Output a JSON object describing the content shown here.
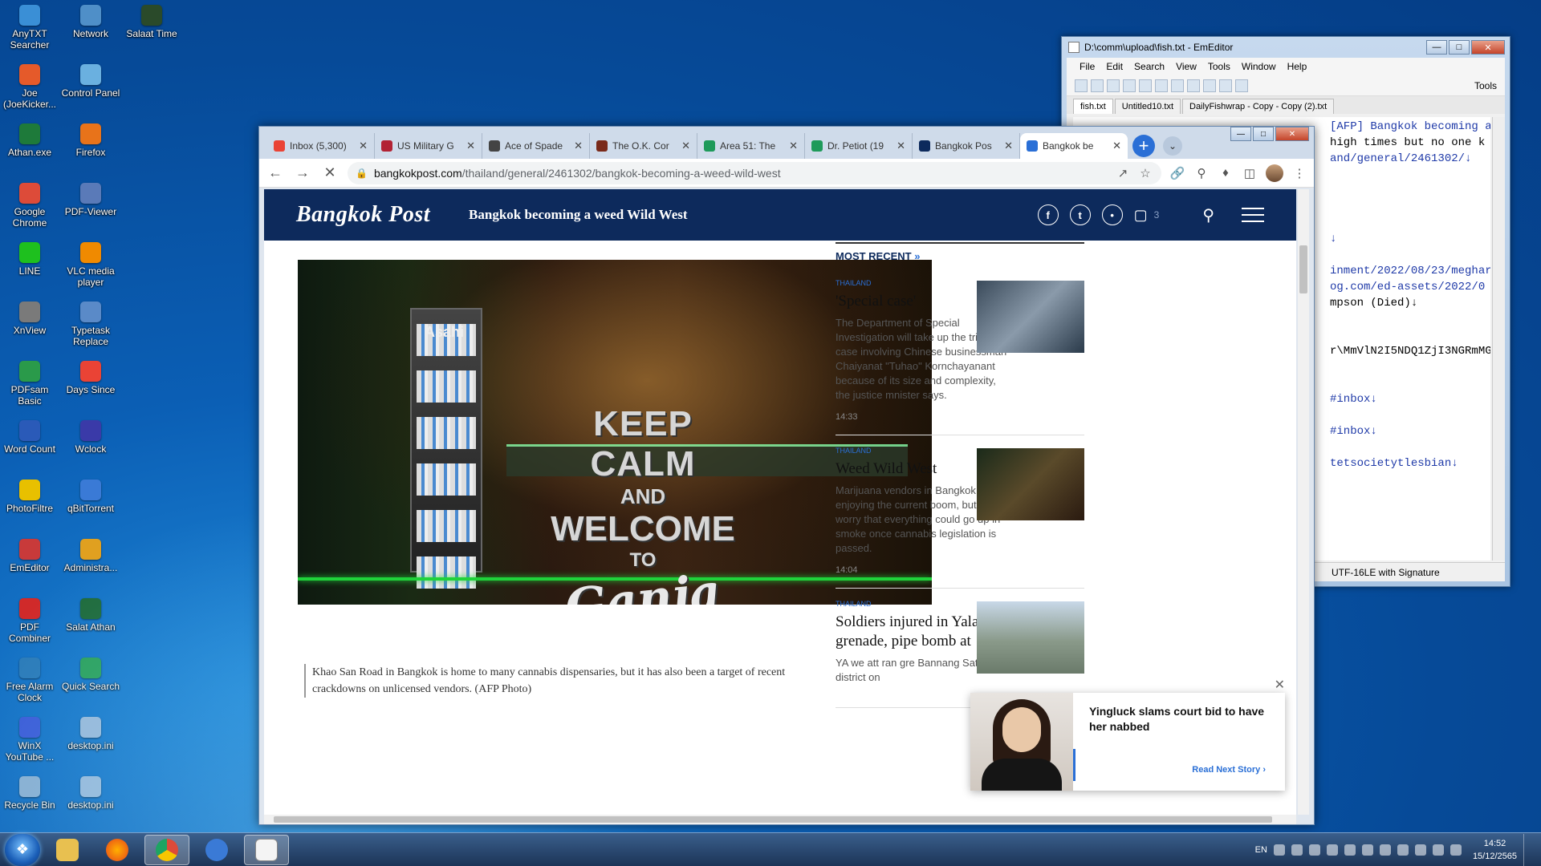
{
  "desktop": {
    "icons": [
      {
        "label": "AnyTXT Searcher",
        "color": "#3a8fd6"
      },
      {
        "label": "Network",
        "color": "#4f8fc8"
      },
      {
        "label": "Salaat Time",
        "color": "#2a4a2a"
      },
      {
        "label": "Joe (JoeKicker...",
        "color": "#e55a2a"
      },
      {
        "label": "Control Panel",
        "color": "#6ab0e0"
      },
      {
        "label": "Athan.exe",
        "color": "#1e7a3a"
      },
      {
        "label": "Firefox",
        "color": "#e8731a"
      },
      {
        "label": "Google Chrome",
        "color": "#dd4b39"
      },
      {
        "label": "PDF-Viewer",
        "color": "#5a7ab8"
      },
      {
        "label": "LINE",
        "color": "#1ec01e"
      },
      {
        "label": "VLC media player",
        "color": "#f08a00"
      },
      {
        "label": "XnView",
        "color": "#7a7a7a"
      },
      {
        "label": "Typetask Replace",
        "color": "#5a8ac8"
      },
      {
        "label": "PDFsam Basic",
        "color": "#2a9a4a"
      },
      {
        "label": "Days Since",
        "color": "#ea4335"
      },
      {
        "label": "Word Count",
        "color": "#2a5ab8"
      },
      {
        "label": "Wclock",
        "color": "#3a3aa8"
      },
      {
        "label": "PhotoFiltre",
        "color": "#e8c000"
      },
      {
        "label": "qBitTorrent",
        "color": "#3a7ad6"
      },
      {
        "label": "EmEditor",
        "color": "#c83a3a"
      },
      {
        "label": "Administra...",
        "color": "#e0a020"
      },
      {
        "label": "PDF Combiner",
        "color": "#d02a2a"
      },
      {
        "label": "Salat Athan",
        "color": "#1e6a3a"
      },
      {
        "label": "Free Alarm Clock",
        "color": "#2a7ab8"
      },
      {
        "label": "Quick Search",
        "color": "#2aa05a"
      },
      {
        "label": "WinX YouTube ...",
        "color": "#3a5ad6"
      },
      {
        "label": "desktop.ini",
        "color": "#9ab8d8"
      },
      {
        "label": "Recycle Bin",
        "color": "#8aaed0"
      },
      {
        "label": "desktop.ini",
        "color": "#9ab8d8"
      }
    ]
  },
  "emeditor": {
    "title": "D:\\comm\\upload\\fish.txt - EmEditor",
    "menu": [
      "File",
      "Edit",
      "Search",
      "View",
      "Tools",
      "Window",
      "Help"
    ],
    "tools_label": "Tools",
    "tabs": [
      "fish.txt",
      "Untitled10.txt",
      "DailyFishwrap - Copy - Copy (2).txt"
    ],
    "lines": [
      "[AFP] Bangkok becoming a weed Wild West↓",
      "high times but no one k",
      "and/general/2461302/↓",
      "",
      "",
      "",
      "",
      "↓",
      "",
      "inment/2022/08/23/meghar",
      "og.com/ed-assets/2022/0",
      "mpson (Died)↓",
      "",
      "",
      "r\\MmVlN2I5NDQ1ZjI3NGRmMG",
      "",
      "",
      "#inbox↓",
      "",
      "#inbox↓",
      "",
      "tetsocietytlesbian↓"
    ],
    "status": "UTF-16LE with Signature"
  },
  "browser": {
    "tabs": [
      {
        "title": "Inbox (5,300)",
        "color": "#ea4335"
      },
      {
        "title": "US Military G",
        "color": "#b22234"
      },
      {
        "title": "Ace of Spade",
        "color": "#444444"
      },
      {
        "title": "The O.K. Cor",
        "color": "#7a2a1a"
      },
      {
        "title": "Area 51: The",
        "color": "#1e9a5a"
      },
      {
        "title": "Dr. Petiot (19",
        "color": "#1e9a5a"
      },
      {
        "title": "Bangkok Pos",
        "color": "#0d2a5c"
      },
      {
        "title": "Bangkok be",
        "color": "#2a6fd6"
      }
    ],
    "url_host": "bangkokpost.com",
    "url_path": "/thailand/general/2461302/bangkok-becoming-a-weed-wild-west"
  },
  "page": {
    "logo": "Bangkok Post",
    "headline": "Bangkok becoming a weed Wild West",
    "comment_count": "3",
    "hero": {
      "brand": "Asahi",
      "sign_l1": "KEEP CALM",
      "sign_l2": "AND",
      "sign_l3": "WELCOME",
      "sign_l4": "TO",
      "sign_l5": "Ganja"
    },
    "caption": "Khao San Road in Bangkok is home to many cannabis dispensaries, but it has also been a target of recent crackdowns on unlicensed vendors. (AFP Photo)",
    "most_recent_label": "MOST RECENT",
    "stories": [
      {
        "category": "THAILAND",
        "headline": "'Special case'",
        "summary": "The Department of Special Investigation will take up the triads case involving Chinese businessman Chaiyanat \"Tuhao\" Kornchayanant because of its size and complexity, the justice mnister says.",
        "time": "14:33"
      },
      {
        "category": "THAILAND",
        "headline": "Weed Wild West",
        "summary": "Marijuana vendors in Bangkok are enjoying the current boom, but many worry that everything could go up in smoke once cannabis legislation is passed.",
        "time": "14:04"
      },
      {
        "category": "THAILAND",
        "headline": "Soldiers injured in Yala grenade, pipe bomb at",
        "summary": "YA we att ran gre Bannang Sata district on",
        "time": ""
      }
    ],
    "popup": {
      "headline": "Yingluck slams court bid to have her nabbed",
      "link": "Read Next Story"
    }
  },
  "taskbar": {
    "language": "EN",
    "time": "14:52",
    "date": "15/12/2565"
  }
}
